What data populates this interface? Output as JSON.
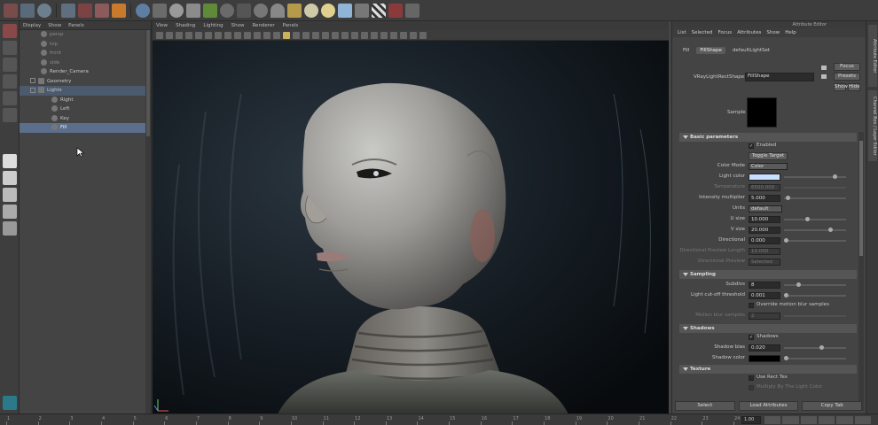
{
  "shelf": {
    "icons": [
      "select-tool-icon",
      "move-tool-icon",
      "rotate-icon",
      "render-icon",
      "render-settings-icon",
      "ipr-icon",
      "hypershade-icon",
      "sphere-icon",
      "cube-icon",
      "plane-icon",
      "light-icon",
      "sun-icon",
      "camera-icon",
      "checker-icon",
      "frame-buffer-icon",
      "misc-icon"
    ]
  },
  "outliner": {
    "menu": [
      "Display",
      "Show",
      "Panels"
    ],
    "nodes": [
      {
        "label": "persp",
        "level": 2,
        "dim": true
      },
      {
        "label": "top",
        "level": 2,
        "dim": true
      },
      {
        "label": "front",
        "level": 2,
        "dim": true
      },
      {
        "label": "side",
        "level": 2,
        "dim": true
      },
      {
        "label": "Render_Camera",
        "level": 2,
        "dim": false
      },
      {
        "label": "Geometry",
        "level": 1,
        "dim": false
      },
      {
        "label": "Lights",
        "level": 1,
        "dim": false
      },
      {
        "label": "Right",
        "level": 2,
        "dim": false
      },
      {
        "label": "Left",
        "level": 2,
        "dim": false
      },
      {
        "label": "Key",
        "level": 2,
        "dim": false
      },
      {
        "label": "Fill",
        "level": 2,
        "dim": false
      }
    ]
  },
  "viewport": {
    "menu": [
      "View",
      "Shading",
      "Lighting",
      "Show",
      "Renderer",
      "Panels"
    ]
  },
  "attribute_editor": {
    "title": "Attribute Editor",
    "menu": [
      "List",
      "Selected",
      "Focus",
      "Attributes",
      "Show",
      "Help"
    ],
    "tabs": [
      "Fill",
      "FillShape",
      "defaultLightSet"
    ],
    "node_type_label": "VRayLightRectShape:",
    "node_name": "FillShape",
    "focus_label": "Focus",
    "presets_label": "Presets",
    "show_label": "Show",
    "hide_label": "Hide",
    "sample_label": "Sample",
    "basic": {
      "header": "Basic parameters",
      "enabled_label": "Enabled",
      "toggle_target": "Toggle Target",
      "color_mode_label": "Color Mode",
      "color_mode_value": "Color",
      "light_color_label": "Light color",
      "light_color": "#c8e0ff",
      "temperature_label": "Temperature",
      "temperature_value": "6500.000",
      "intensity_label": "Intensity multiplier",
      "intensity_value": "5.000",
      "units_label": "Units",
      "units_value": "default",
      "usize_label": "U size",
      "usize_value": "10.000",
      "vsize_label": "V size",
      "vsize_value": "20.000",
      "directional_label": "Directional",
      "directional_value": "0.000",
      "dir_preview_len_label": "Directional Preview Length",
      "dir_preview_len_value": "10.000",
      "dir_preview_label": "Directional Preview",
      "dir_preview_value": "Selected"
    },
    "sampling": {
      "header": "Sampling",
      "subdivs_label": "Subdivs",
      "subdivs_value": "8",
      "cutoff_label": "Light cut-off threshold",
      "cutoff_value": "0.001",
      "override_label": "Override motion blur samples",
      "motion_label": "Motion blur samples",
      "motion_value": "2"
    },
    "shadows": {
      "header": "Shadows",
      "shadows_label": "Shadows",
      "bias_label": "Shadow bias",
      "bias_value": "0.020",
      "color_label": "Shadow color",
      "shadow_color": "#000000"
    },
    "texture": {
      "header": "Texture",
      "use_rect_label": "Use Rect Tex",
      "multiply_label": "Multiply By The Light Color"
    },
    "bottom": {
      "select": "Select",
      "load": "Load Attributes",
      "copy": "Copy Tab"
    }
  },
  "side_tabs": [
    "Attribute Editor",
    "Channel Box / Layer Editor"
  ],
  "timeline": {
    "ticks": [
      "1",
      "2",
      "3",
      "4",
      "5",
      "6",
      "7",
      "8",
      "9",
      "10",
      "11",
      "12",
      "13",
      "14",
      "15",
      "16",
      "17",
      "18",
      "19",
      "20",
      "21",
      "22",
      "23",
      "24"
    ],
    "current": "1.00"
  }
}
